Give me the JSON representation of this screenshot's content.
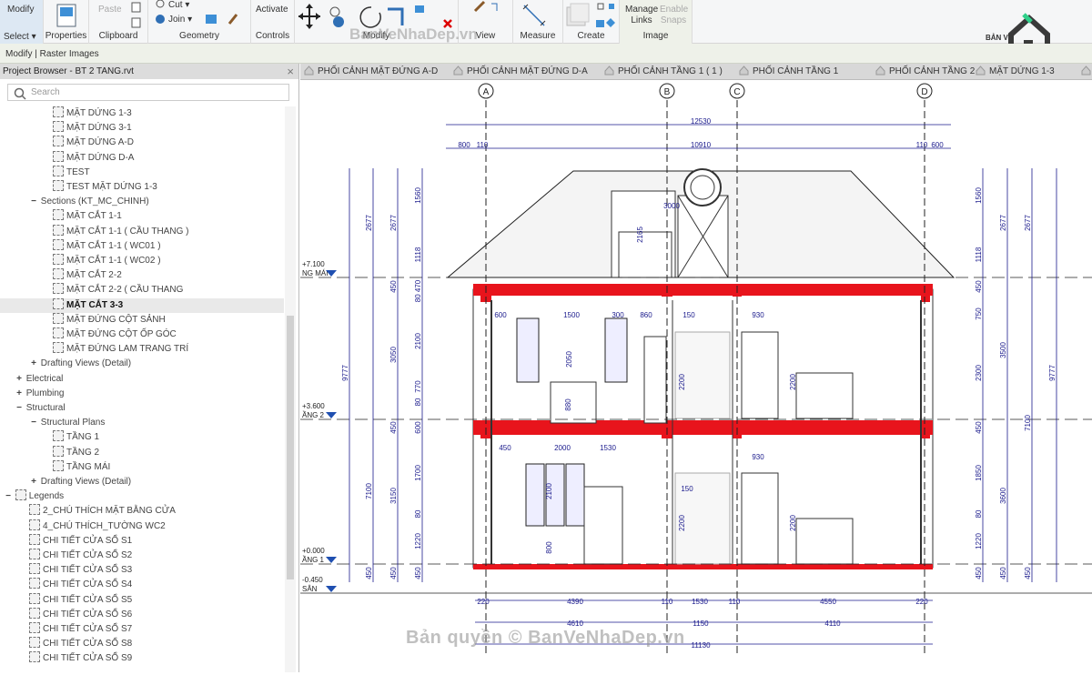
{
  "ribbon": {
    "modify": "Modify",
    "select": "Select ▾",
    "properties": "Properties",
    "paste": "Paste",
    "clipboard": "Clipboard",
    "cut": "Cut ▾",
    "join": "Join ▾",
    "geometry": "Geometry",
    "activate": "Activate",
    "controls": "Controls",
    "modify_panel": "Modify",
    "view": "View",
    "measure": "Measure",
    "create": "Create",
    "manage_links": "Manage Links",
    "enable_snaps": "Enable Snaps",
    "image": "Image"
  },
  "context_bar": "Modify | Raster Images",
  "project_browser": {
    "title": "Project Browser - BT 2 TANG.rvt",
    "search_placeholder": "Search",
    "items": [
      "MẶT DỨNG 1-3",
      "MẶT DỨNG 3-1",
      "MẶT DỨNG A-D",
      "MẶT DỨNG D-A",
      "TEST",
      "TEST MẶT DỨNG 1-3",
      "Sections (KT_MC_CHINH)",
      "MẶT CẮT 1-1",
      "MẶT CẮT 1-1 ( CẦU THANG )",
      "MẶT CẮT 1-1 ( WC01 )",
      "MẶT CẮT 1-1 ( WC02 )",
      "MẶT CẮT 2-2",
      "MẶT CẮT 2-2 ( CẦU THANG",
      "MẶT CẮT 3-3",
      "MẶT ĐỨNG CỘT SẢNH",
      "MẶT ĐỨNG CỘT ỐP GÓC",
      "MẶT ĐỨNG LAM TRANG TRÍ",
      "Drafting Views (Detail)",
      "Electrical",
      "Plumbing",
      "Structural",
      "Structural Plans",
      "TẦNG 1",
      "TẦNG 2",
      "TẦNG MÁI",
      "Drafting Views (Detail)",
      "Legends",
      "2_CHÚ THÍCH MẶT BẰNG CỬA",
      "4_CHÚ THÍCH_TƯỜNG WC2",
      "CHI TIẾT CỬA SỔ S1",
      "CHI TIẾT CỬA SỔ S2",
      "CHI TIẾT CỬA SỔ S3",
      "CHI TIẾT CỬA SỔ S4",
      "CHI TIẾT CỬA SỔ S5",
      "CHI TIẾT CỬA SỔ S6",
      "CHI TIẾT CỬA SỔ S7",
      "CHI TIẾT CỬA SỔ S8",
      "CHI TIẾT CỬA SỔ S9"
    ],
    "selected": "MẶT CẮT 3-3"
  },
  "tabs": [
    "PHỐI CẢNH MẶT ĐỨNG A-D",
    "PHỐI CẢNH MẶT ĐỨNG D-A",
    "PHỐI CẢNH TẦNG 1 ( 1 )",
    "PHỐI CẢNH TẦNG 1",
    "PHỐI CẢNH TẦNG 2",
    "MẶT DỨNG 1-3"
  ],
  "drawing": {
    "grids": [
      "A",
      "B",
      "C",
      "D"
    ],
    "levels": [
      {
        "elev": "+7.100",
        "name": "NG MÁI"
      },
      {
        "elev": "+3.600",
        "name": "ẦNG 2"
      },
      {
        "elev": "+0.000",
        "name": "ẦNG 1"
      },
      {
        "elev": "-0.450",
        "name": "SÂN"
      }
    ],
    "dims_top": [
      "12530",
      "800",
      "110",
      "10910",
      "110",
      "600"
    ],
    "dims_bottom": [
      "220",
      "4390",
      "110",
      "1530",
      "110",
      "4550",
      "220",
      "4610",
      "1150",
      "4110",
      "11130"
    ],
    "dims_left": [
      "9777",
      "7100",
      "2677",
      "3050",
      "3150",
      "450",
      "2677",
      "450",
      "450",
      "450",
      "1560",
      "1118",
      "80 470",
      "2100",
      "770",
      "80",
      "600",
      "1700",
      "80",
      "1220",
      "450"
    ],
    "dims_right": [
      "1560",
      "1118",
      "450",
      "750",
      "2300",
      "450",
      "1850",
      "3600",
      "80",
      "1220",
      "450",
      "2677",
      "3500",
      "7100",
      "9777",
      "2677",
      "450",
      "450"
    ],
    "dims_inner": [
      "3000",
      "2165",
      "600",
      "1500",
      "300",
      "860",
      "150",
      "930",
      "2050",
      "2200",
      "2200",
      "880",
      "450",
      "2000",
      "1530",
      "2100",
      "150",
      "930",
      "2200",
      "2200",
      "800"
    ]
  },
  "watermarks": {
    "top": "BanVeNhaDep.vn",
    "bottom": "Bản quyền © BanVeNhaDep.vn",
    "logo": "BẢN VẼ NHÀ ĐẸP"
  },
  "colors": {
    "structure": "#e8141c",
    "dimension": "#1a1a8c",
    "ribbon_bg": "#f5f6f7",
    "tab_bar": "#d8d8d8",
    "logo_green": "#2fd08a",
    "logo_dark": "#3a3a3a"
  }
}
